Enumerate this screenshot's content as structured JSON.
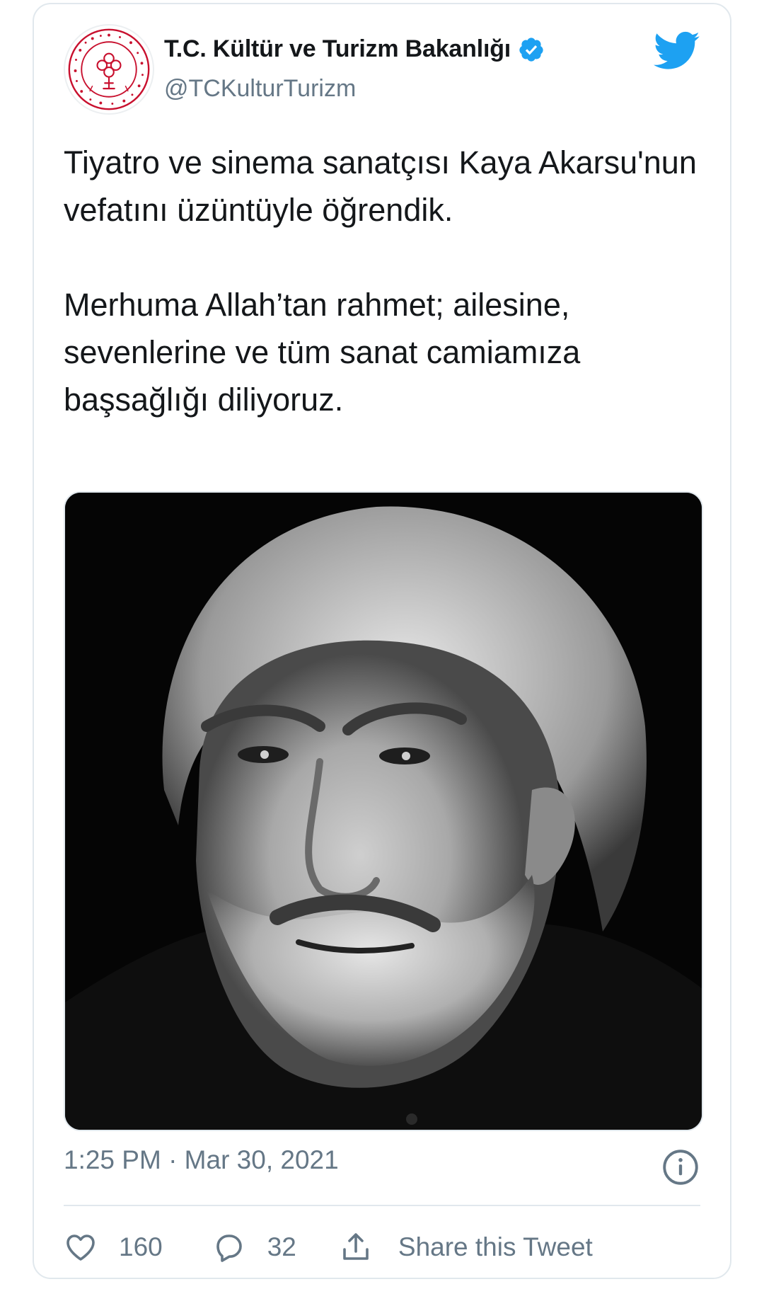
{
  "account": {
    "display_name": "T.C. Kültür ve Turizm Bakanlığı",
    "handle": "@TCKulturTurizm",
    "verified_icon": "verified-badge-icon",
    "avatar_icon": "ministry-emblem-logo",
    "brand_icon": "twitter-bird-icon"
  },
  "tweet": {
    "paragraphs": [
      "Tiyatro ve sinema sanatçısı Kaya Akarsu'nun vefatını üzüntüyle öğrendik.",
      "Merhuma Allah’tan rahmet; ailesine, sevenlerine ve tüm sanat camiamıza başsağlığı diliyoruz."
    ],
    "timestamp": "1:25 PM · Mar 30, 2021"
  },
  "actions": {
    "like_count": "160",
    "reply_count": "32",
    "share_label": "Share this Tweet"
  },
  "colors": {
    "text": "#14171a",
    "secondary": "#657786",
    "accent": "#1da1f2",
    "border": "#e1e8ed",
    "emblem": "#c8102e"
  }
}
